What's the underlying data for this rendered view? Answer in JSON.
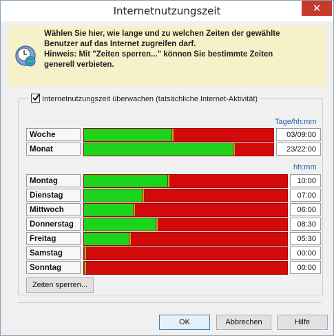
{
  "window": {
    "title": "Internetnutzungszeit",
    "close_glyph": "✕"
  },
  "header": {
    "icon": "clock-globe-icon",
    "lines": [
      "Wählen Sie hier, wie lange und zu welchen Zeiten der gewählte",
      "Benutzer auf das Internet zugreifen darf.",
      "Hinweis: Mit \"Zeiten sperren...\" können Sie bestimmte Zeiten",
      "generell verbieten."
    ]
  },
  "monitor": {
    "checked": true,
    "label": "Internetnutzungszeit überwachen (tatsächliche Internet-Aktivität)"
  },
  "colors": {
    "allowed": "#1bd41b",
    "blocked": "#d20a0a",
    "marker": "#e09a2a",
    "link": "#1f62b0"
  },
  "periods": {
    "unit_label": "Tage/hh:mm",
    "rows": [
      {
        "label": "Woche",
        "value": "03/09:00",
        "fraction": 0.463
      },
      {
        "label": "Monat",
        "value": "23/22:00",
        "fraction": 0.784
      }
    ]
  },
  "days": {
    "unit_label": "hh:mm",
    "rows": [
      {
        "label": "Montag",
        "value": "10:00",
        "fraction": 0.411
      },
      {
        "label": "Dienstag",
        "value": "07:00",
        "fraction": 0.285
      },
      {
        "label": "Mittwoch",
        "value": "06:00",
        "fraction": 0.241
      },
      {
        "label": "Donnerstag",
        "value": "08:30",
        "fraction": 0.352
      },
      {
        "label": "Freitag",
        "value": "05:30",
        "fraction": 0.221
      },
      {
        "label": "Samstag",
        "value": "00:00",
        "fraction": 0.0
      },
      {
        "label": "Sonntag",
        "value": "00:00",
        "fraction": 0.0
      }
    ]
  },
  "buttons": {
    "lock_times": "Zeiten sperren...",
    "ok": "OK",
    "cancel": "Abbrechen",
    "help": "Hilfe"
  }
}
